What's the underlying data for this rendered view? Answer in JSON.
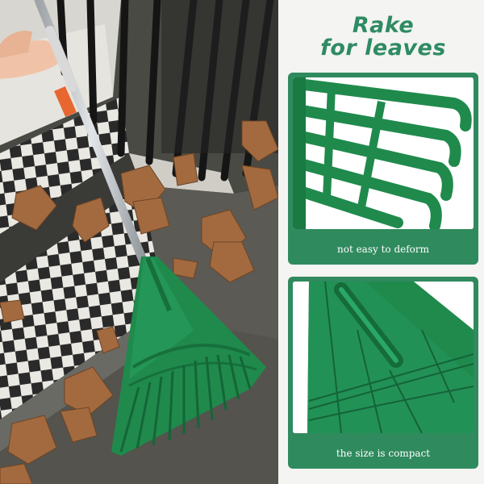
{
  "headline": {
    "line1": "Rake",
    "line2": "for leaves"
  },
  "cards": [
    {
      "caption": "not easy to deform",
      "icon": "rake-tines-closeup"
    },
    {
      "caption": "the size is compact",
      "icon": "rake-head-closeup"
    }
  ],
  "colors": {
    "brand_green": "#2f8a5e",
    "headline_green": "#2e8b63",
    "rake_green": "#1f8a4c",
    "handle_silver": "#c8ccd0",
    "grip_orange": "#e8662f"
  }
}
